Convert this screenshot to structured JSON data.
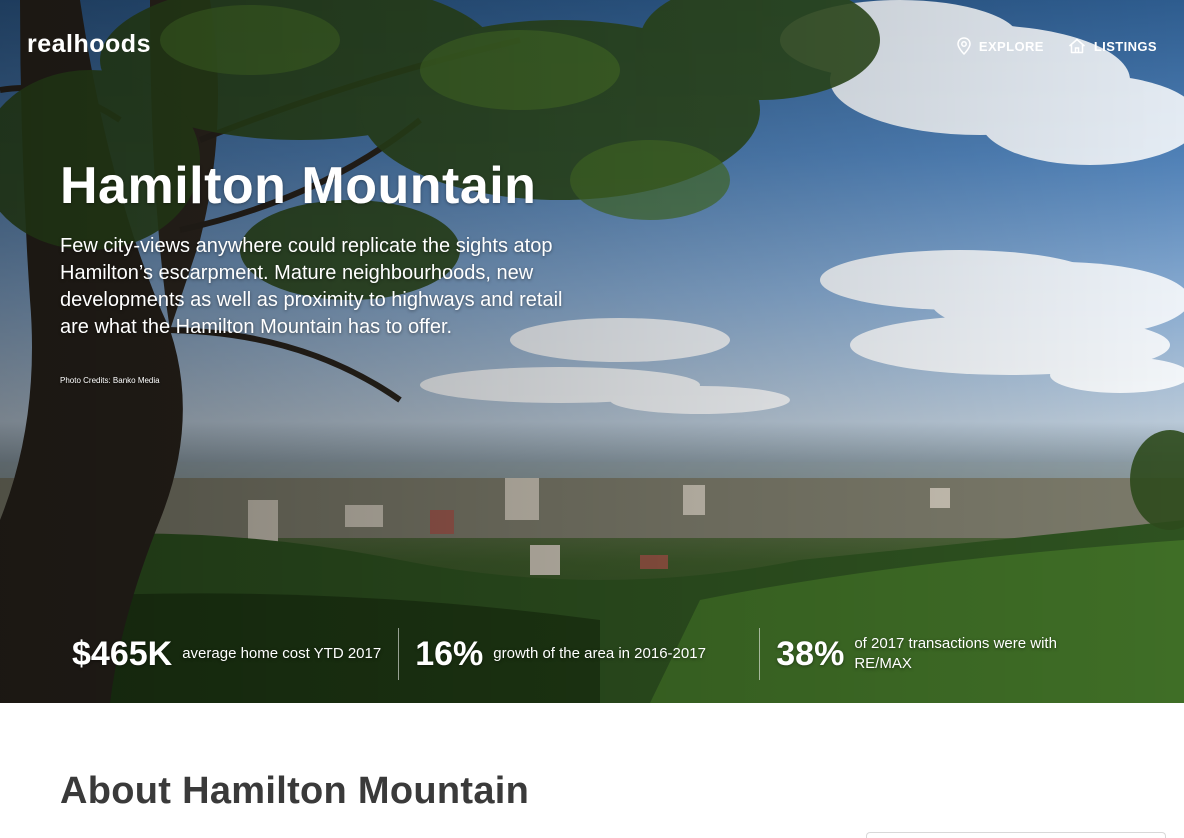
{
  "brand": {
    "logo": "realhoods"
  },
  "nav": {
    "items": [
      {
        "label": "EXPLORE",
        "icon": "map-pin-icon"
      },
      {
        "label": "LISTINGS",
        "icon": "house-icon"
      }
    ]
  },
  "hero": {
    "title": "Hamilton Mountain",
    "description": "Few city-views anywhere could replicate the sights atop Hamilton’s escarpment. Mature neighbourhoods, new developments as well as proximity to highways and retail are what the Hamilton Mountain has to offer.",
    "photo_credit": "Photo Credits: Banko Media"
  },
  "stats": [
    {
      "value": "$465K",
      "text": "average home cost YTD 2017"
    },
    {
      "value": "16%",
      "text": "growth of the area in 2016-2017"
    },
    {
      "value": "38%",
      "text": "of 2017 transactions were with RE/MAX"
    }
  ],
  "about": {
    "title": "About Hamilton Mountain"
  },
  "colors": {
    "heading_text": "#3a3a3a",
    "hero_text": "#ffffff"
  }
}
